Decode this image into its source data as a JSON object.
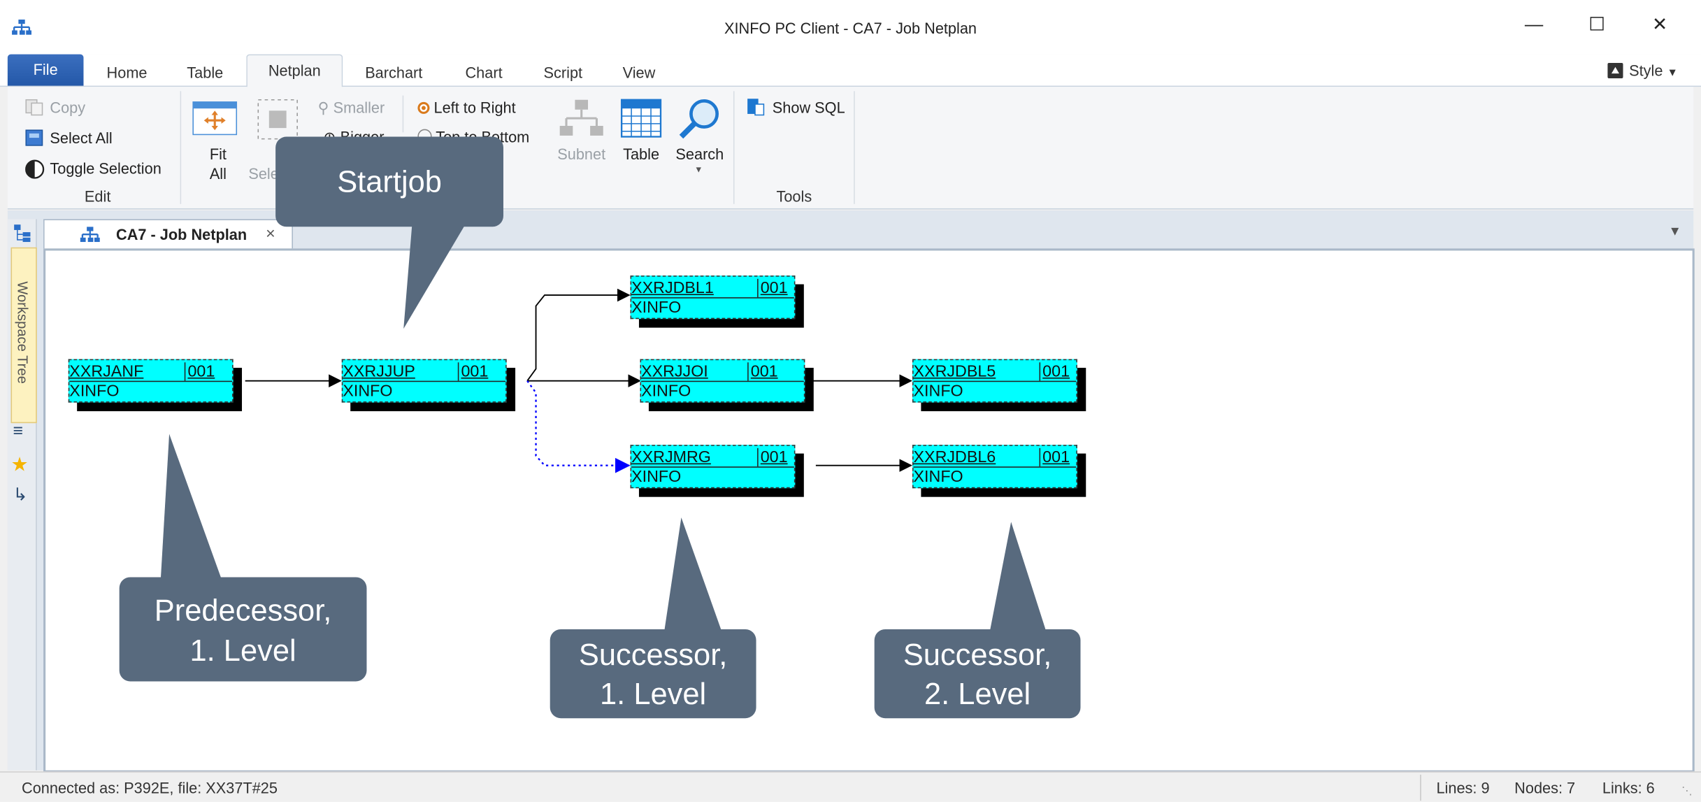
{
  "window": {
    "title": "XINFO PC Client - CA7 - Job Netplan"
  },
  "ribbon_tabs": [
    "File",
    "Home",
    "Table",
    "Netplan",
    "Barchart",
    "Chart",
    "Script",
    "View"
  ],
  "style_label": "Style",
  "edit_group": {
    "copy": "Copy",
    "select_all": "Select All",
    "toggle_selection": "Toggle Selection",
    "label": "Edit"
  },
  "view_group": {
    "fit_all": "Fit",
    "fit_all_2": "All",
    "fit_sel_1": "F",
    "fit_sel_2": "Sele",
    "smaller": "Smaller",
    "bigger": "Bigger",
    "left_to_right": "Left to Right",
    "top_to_bottom": "Top to Bottom"
  },
  "tools_btns": {
    "subnet": "Subnet",
    "table": "Table",
    "search": "Search"
  },
  "tools_group": {
    "show_sql": "Show SQL",
    "label": "Tools"
  },
  "side_strip": {
    "workspace_tree": "Workspace Tree"
  },
  "document_tab": {
    "label": "CA7 - Job Netplan",
    "close": "×"
  },
  "nodes": [
    {
      "job": "XXRJANF",
      "num": "001",
      "system": "XINFO"
    },
    {
      "job": "XXRJJUP",
      "num": "001",
      "system": "XINFO"
    },
    {
      "job": "XXRJDBL1",
      "num": "001",
      "system": "XINFO"
    },
    {
      "job": "XXRJJOI",
      "num": "001",
      "system": "XINFO"
    },
    {
      "job": "XXRJMRG",
      "num": "001",
      "system": "XINFO"
    },
    {
      "job": "XXRJDBL5",
      "num": "001",
      "system": "XINFO"
    },
    {
      "job": "XXRJDBL6",
      "num": "001",
      "system": "XINFO"
    }
  ],
  "callouts": {
    "startjob": "Startjob",
    "pred_1": "Predecessor,",
    "pred_2": "1. Level",
    "succ1_1": "Successor,",
    "succ1_2": "1. Level",
    "succ2_1": "Successor,",
    "succ2_2": "2. Level"
  },
  "status": {
    "connected": "Connected as: P392E, file: XX37T#25",
    "lines": "Lines: 9",
    "nodes": "Nodes: 7",
    "links": "Links: 6"
  },
  "colors": {
    "node_fill": "#00ffff",
    "callout": "#586a7e",
    "file_tab": "#2b579a",
    "dotted_link": "#0000ff"
  }
}
